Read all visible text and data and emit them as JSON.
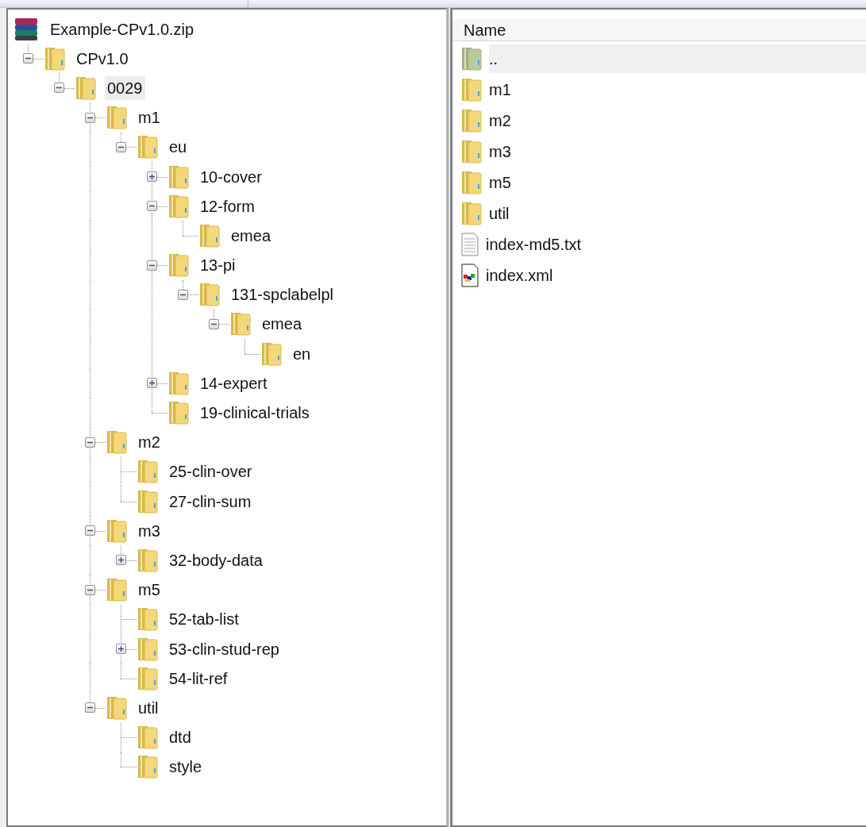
{
  "tree": {
    "label": "Example-CPv1.0.zip",
    "kind": "archive",
    "selected": false,
    "children": [
      {
        "label": "CPv1.0",
        "selected": false,
        "expanded": true,
        "children": [
          {
            "label": "0029",
            "selected": true,
            "expanded": true,
            "children": [
              {
                "label": "m1",
                "selected": false,
                "expanded": true,
                "children": [
                  {
                    "label": "eu",
                    "selected": false,
                    "expanded": true,
                    "children": [
                      {
                        "label": "10-cover",
                        "selected": false,
                        "expanded": false
                      },
                      {
                        "label": "12-form",
                        "selected": false,
                        "expanded": true,
                        "children": [
                          {
                            "label": "emea",
                            "selected": false
                          }
                        ]
                      },
                      {
                        "label": "13-pi",
                        "selected": false,
                        "expanded": true,
                        "children": [
                          {
                            "label": "131-spclabelpl",
                            "selected": false,
                            "expanded": true,
                            "children": [
                              {
                                "label": "emea",
                                "selected": false,
                                "expanded": true,
                                "children": [
                                  {
                                    "label": "en",
                                    "selected": false
                                  }
                                ]
                              }
                            ]
                          }
                        ]
                      },
                      {
                        "label": "14-expert",
                        "selected": false,
                        "expanded": false
                      },
                      {
                        "label": "19-clinical-trials",
                        "selected": false
                      }
                    ]
                  }
                ]
              },
              {
                "label": "m2",
                "selected": false,
                "expanded": true,
                "children": [
                  {
                    "label": "25-clin-over",
                    "selected": false
                  },
                  {
                    "label": "27-clin-sum",
                    "selected": false
                  }
                ]
              },
              {
                "label": "m3",
                "selected": false,
                "expanded": true,
                "children": [
                  {
                    "label": "32-body-data",
                    "selected": false,
                    "expanded": false
                  }
                ]
              },
              {
                "label": "m5",
                "selected": false,
                "expanded": true,
                "children": [
                  {
                    "label": "52-tab-list",
                    "selected": false
                  },
                  {
                    "label": "53-clin-stud-rep",
                    "selected": false,
                    "expanded": false
                  },
                  {
                    "label": "54-lit-ref",
                    "selected": false
                  }
                ]
              },
              {
                "label": "util",
                "selected": false,
                "expanded": true,
                "children": [
                  {
                    "label": "dtd",
                    "selected": false
                  },
                  {
                    "label": "style",
                    "selected": false
                  }
                ]
              }
            ]
          }
        ]
      }
    ]
  },
  "list": {
    "columns": [
      "Name"
    ],
    "items": [
      {
        "name": "..",
        "kind": "up",
        "selected": true
      },
      {
        "name": "m1",
        "kind": "folder",
        "selected": false
      },
      {
        "name": "m2",
        "kind": "folder",
        "selected": false
      },
      {
        "name": "m3",
        "kind": "folder",
        "selected": false
      },
      {
        "name": "m5",
        "kind": "folder",
        "selected": false
      },
      {
        "name": "util",
        "kind": "folder",
        "selected": false
      },
      {
        "name": "index-md5.txt",
        "kind": "text",
        "selected": false
      },
      {
        "name": "index.xml",
        "kind": "xml",
        "selected": false
      }
    ]
  }
}
